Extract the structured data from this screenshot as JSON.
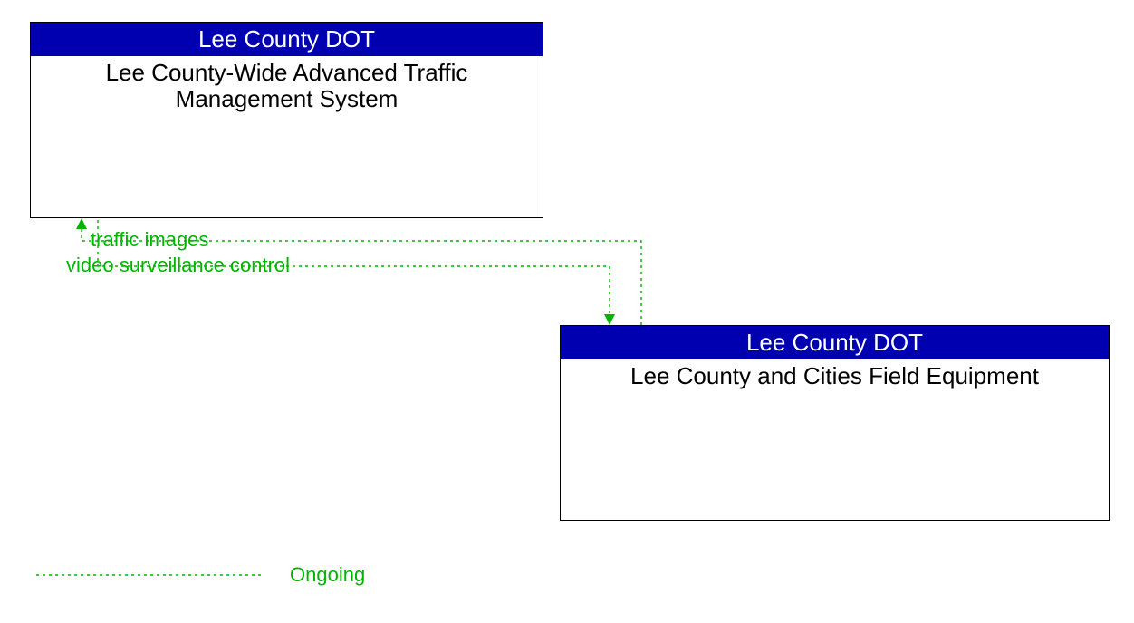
{
  "colors": {
    "header_bg": "#0000b0",
    "flow": "#00b400"
  },
  "nodes": {
    "atms": {
      "header": "Lee County DOT",
      "body": "Lee County-Wide Advanced Traffic Management System"
    },
    "field": {
      "header": "Lee County DOT",
      "body": "Lee County and Cities Field Equipment"
    }
  },
  "flows": {
    "to_atms": "traffic images",
    "to_field": "video surveillance control"
  },
  "legend": {
    "status": "Ongoing"
  }
}
